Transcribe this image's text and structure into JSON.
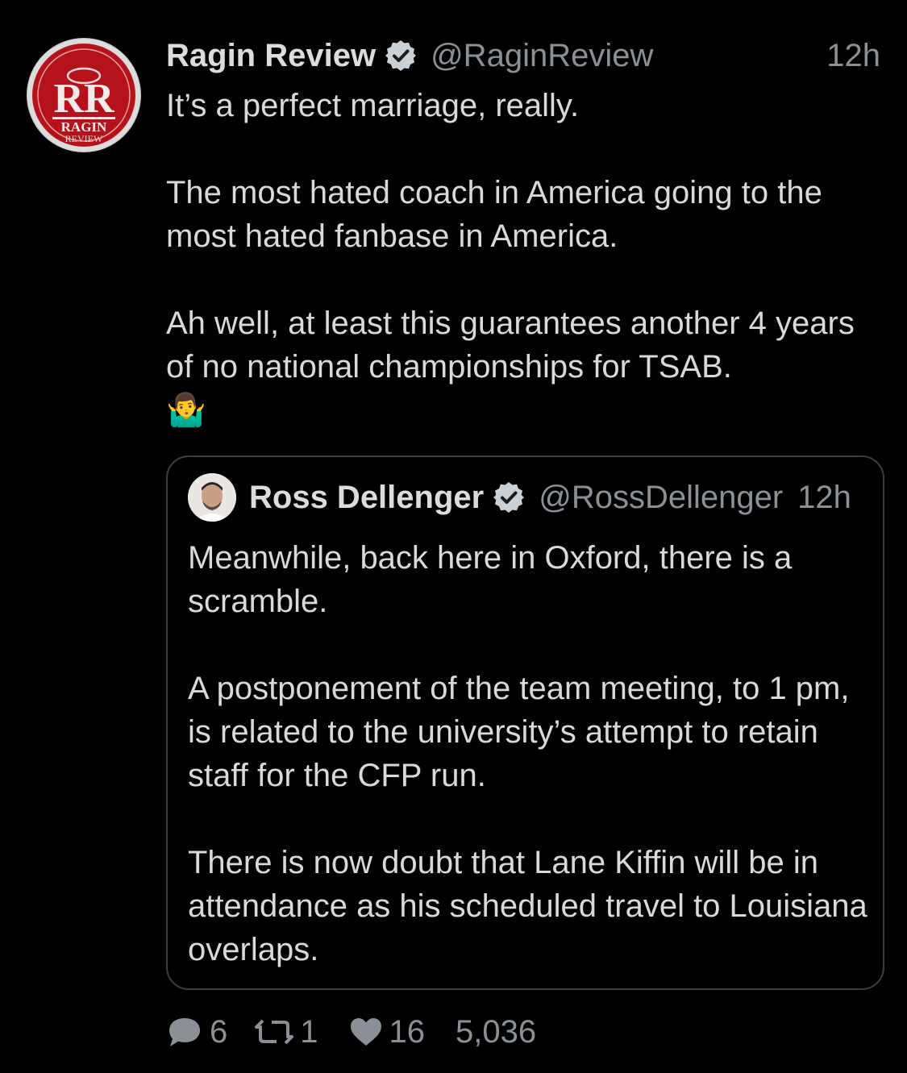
{
  "tweet": {
    "author_name": "Ragin Review",
    "author_handle": "@RaginReview",
    "time": "12h",
    "avatar_logo_text": "RAGIN REVIEW",
    "paragraphs": [
      "It’s a perfect marriage, really.",
      "The most hated coach in America going to the most hated fanbase in America.",
      "Ah well, at least this guarantees another 4 years of no national championships for TSAB."
    ],
    "emoji": "🤷‍♂️"
  },
  "quote": {
    "author_name": "Ross Dellenger",
    "author_handle": "@RossDellenger",
    "time": "12h",
    "paragraphs": [
      "Meanwhile, back here in Oxford, there is a scramble.",
      "A postponement of the team meeting, to 1 pm, is related to the university’s attempt to retain staff for the CFP run.",
      "There is now doubt that Lane Kiffin will be in attendance as his scheduled travel to Louisiana overlaps."
    ]
  },
  "actions": {
    "replies": "6",
    "retweets": "1",
    "likes": "16",
    "views": "5,036"
  },
  "icons": {
    "verified": "verified-badge-icon",
    "reply": "reply-bubble-icon",
    "retweet": "retweet-icon",
    "like": "heart-icon"
  },
  "colors": {
    "background": "#000000",
    "text": "#d9d9d9",
    "muted": "#8a9096",
    "logo_red": "#b5121b"
  }
}
